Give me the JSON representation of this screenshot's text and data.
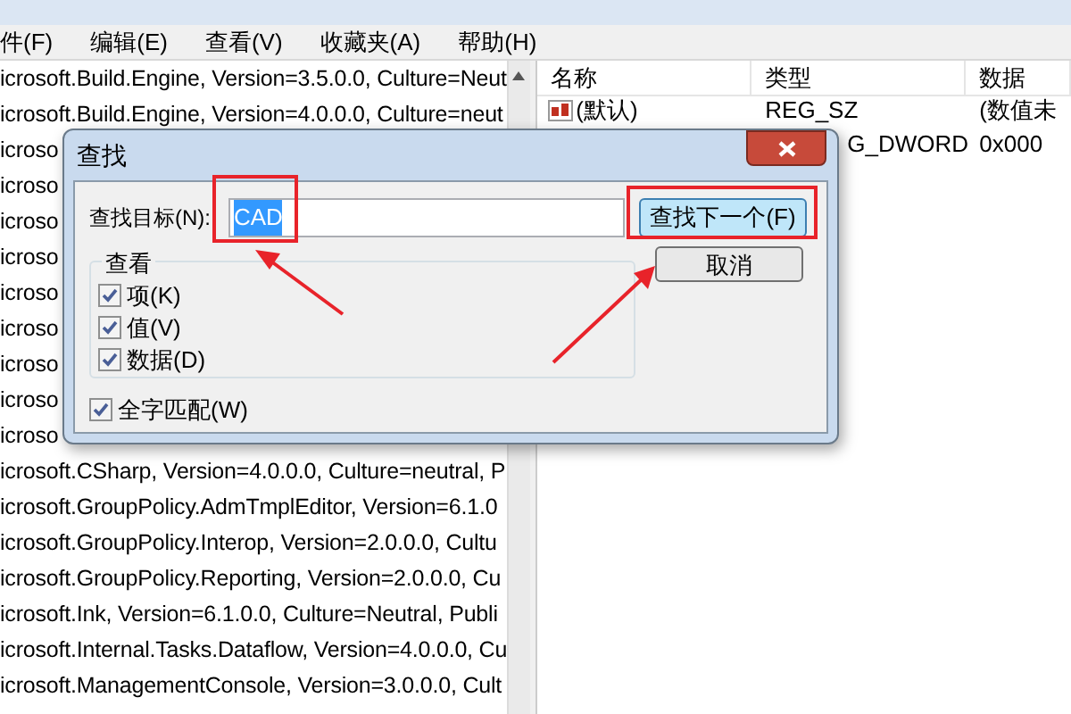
{
  "menu_bar": [
    "件(F)",
    "编辑(E)",
    "查看(V)",
    "收藏夹(A)",
    "帮助(H)"
  ],
  "tree": [
    "icrosoft.Build.Engine, Version=3.5.0.0, Culture=Neut",
    "icrosoft.Build.Engine, Version=4.0.0.0, Culture=neut",
    "icroso",
    "icroso",
    "icroso",
    "icroso",
    "icroso",
    "icroso",
    "icroso",
    "icroso",
    "icroso",
    "icrosoft.CSharp, Version=4.0.0.0, Culture=neutral, P",
    "icrosoft.GroupPolicy.AdmTmplEditor, Version=6.1.0",
    "icrosoft.GroupPolicy.Interop, Version=2.0.0.0, Cultu",
    "icrosoft.GroupPolicy.Reporting, Version=2.0.0.0, Cu",
    "icrosoft.Ink, Version=6.1.0.0, Culture=Neutral, Publi",
    "icrosoft.Internal.Tasks.Dataflow, Version=4.0.0.0, Cu",
    "icrosoft.ManagementConsole, Version=3.0.0.0, Cult"
  ],
  "values": {
    "columns": [
      "名称",
      "类型",
      "数据"
    ],
    "rows": [
      {
        "kind": "string",
        "name": "(默认)",
        "type": "REG_SZ",
        "data": "(数值未"
      },
      {
        "kind": "none",
        "name": "",
        "type": "G_DWORD",
        "data": "0x000"
      }
    ]
  },
  "dialog": {
    "title": "查找",
    "find_label": "查找目标(N):",
    "find_value": "CAD",
    "find_next": "查找下一个(F)",
    "cancel": "取消",
    "group_title": "查看",
    "options": [
      {
        "label": "项(K)",
        "checked": true
      },
      {
        "label": "值(V)",
        "checked": true
      },
      {
        "label": "数据(D)",
        "checked": true
      }
    ],
    "whole_word": {
      "label": "全字匹配(W)",
      "checked": true
    }
  }
}
